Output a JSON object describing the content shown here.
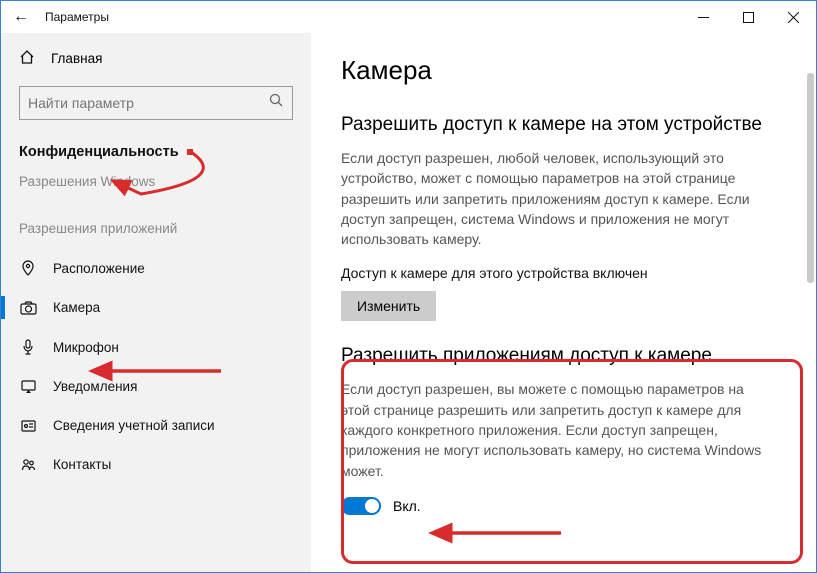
{
  "window": {
    "title": "Параметры"
  },
  "sidebar": {
    "home": "Главная",
    "search_placeholder": "Найти параметр",
    "section": "Конфиденциальность",
    "section_sub": "Разрешения Windows",
    "group": "Разрешения приложений",
    "items": [
      {
        "label": "Расположение"
      },
      {
        "label": "Камера"
      },
      {
        "label": "Микрофон"
      },
      {
        "label": "Уведомления"
      },
      {
        "label": "Сведения учетной записи"
      },
      {
        "label": "Контакты"
      }
    ]
  },
  "content": {
    "title": "Камера",
    "h1": "Разрешить доступ к камере на этом устройстве",
    "p1": "Если доступ разрешен, любой человек, использующий это устройство, может с помощью параметров на этой странице разрешить или запретить приложениям доступ к камере. Если доступ запрещен, система Windows и приложения не могут использовать камеру.",
    "status": "Доступ к камере для этого устройства включен",
    "change": "Изменить",
    "h2": "Разрешить приложениям доступ к камере",
    "p2": "Если доступ разрешен, вы можете с помощью параметров на этой странице разрешить или запретить доступ к камере для каждого конкретного приложения. Если доступ запрещен, приложения не могут использовать камеру, но система Windows может.",
    "toggle_label": "Вкл."
  }
}
